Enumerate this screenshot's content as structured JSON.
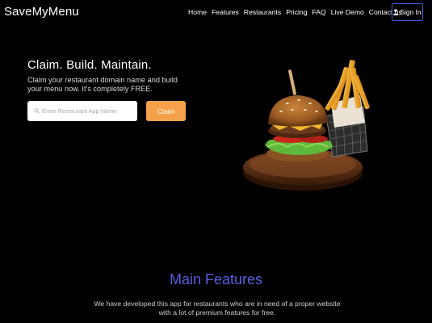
{
  "brand": "SaveMyMenu",
  "nav": {
    "items": [
      "Home",
      "Features",
      "Restaurants",
      "Pricing",
      "FAQ",
      "Live Demo",
      "Contact us"
    ],
    "signin_label": "Sign In"
  },
  "hero": {
    "title": "Claim. Build. Maintain.",
    "subtitle": "Claim your restaurant domain name and build your menu now. It's completely FREE.",
    "search_placeholder": "Enter Restaurant App Name",
    "claim_label": "Claim"
  },
  "features": {
    "title": "Main Features",
    "description": "We have developed this app for restaurants who are in need of a proper website with a lot of premium features for free."
  },
  "colors": {
    "accent_blue": "#5a5fe0",
    "claim_orange": "#f5a04a",
    "signin_border": "#4b55c8",
    "background": "#000000"
  },
  "icons": {
    "signin": "user-icon",
    "search": "search-icon",
    "hero_image": "burger-and-fries-image"
  }
}
